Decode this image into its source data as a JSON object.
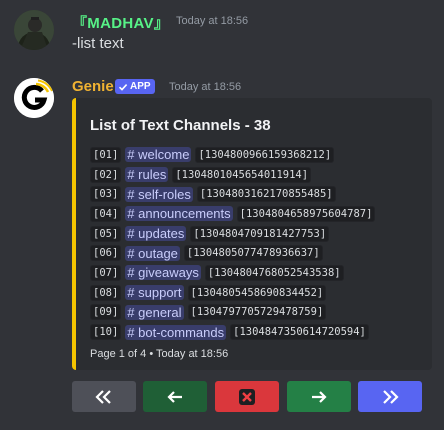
{
  "messages": {
    "user": {
      "name": "『MADHAV』",
      "timestamp": "Today at 18:56",
      "text": "-list text"
    },
    "bot": {
      "name": "Genie",
      "badge": "APP",
      "timestamp": "Today at 18:56"
    }
  },
  "embed": {
    "accent": "#f5c400",
    "title": "List of Text Channels - 38",
    "rows": [
      {
        "index": "[01]",
        "channel": "# welcome",
        "id": "[1304800966159368212]"
      },
      {
        "index": "[02]",
        "channel": "# rules",
        "id": "[1304801045654011914]"
      },
      {
        "index": "[03]",
        "channel": "# self-roles",
        "id": "[1304803162170855485]"
      },
      {
        "index": "[04]",
        "channel": "# announcements",
        "id": "[1304804658975604787]"
      },
      {
        "index": "[05]",
        "channel": "# updates",
        "id": "[1304804709181427753]"
      },
      {
        "index": "[06]",
        "channel": "# outage",
        "id": "[1304805077478936637]"
      },
      {
        "index": "[07]",
        "channel": "# giveaways",
        "id": "[1304804768052543538]"
      },
      {
        "index": "[08]",
        "channel": "# support",
        "id": "[1304805458690834452]"
      },
      {
        "index": "[09]",
        "channel": "# general",
        "id": "[1304797705729478759]"
      },
      {
        "index": "[10]",
        "channel": "# bot-commands",
        "id": "[1304847350614720594]"
      }
    ],
    "footer": "Page 1 of 4 • Today at 18:56"
  },
  "buttons": [
    {
      "name": "first-page-button",
      "icon": "double-left-arrow-icon",
      "color": "#4e5058"
    },
    {
      "name": "previous-page-button",
      "icon": "left-arrow-icon",
      "color": "#1f5f36"
    },
    {
      "name": "close-button",
      "icon": "close-icon",
      "color": "#da373c"
    },
    {
      "name": "next-page-button",
      "icon": "right-arrow-icon",
      "color": "#248046"
    },
    {
      "name": "last-page-button",
      "icon": "double-right-arrow-icon",
      "color": "#5865f2"
    }
  ]
}
